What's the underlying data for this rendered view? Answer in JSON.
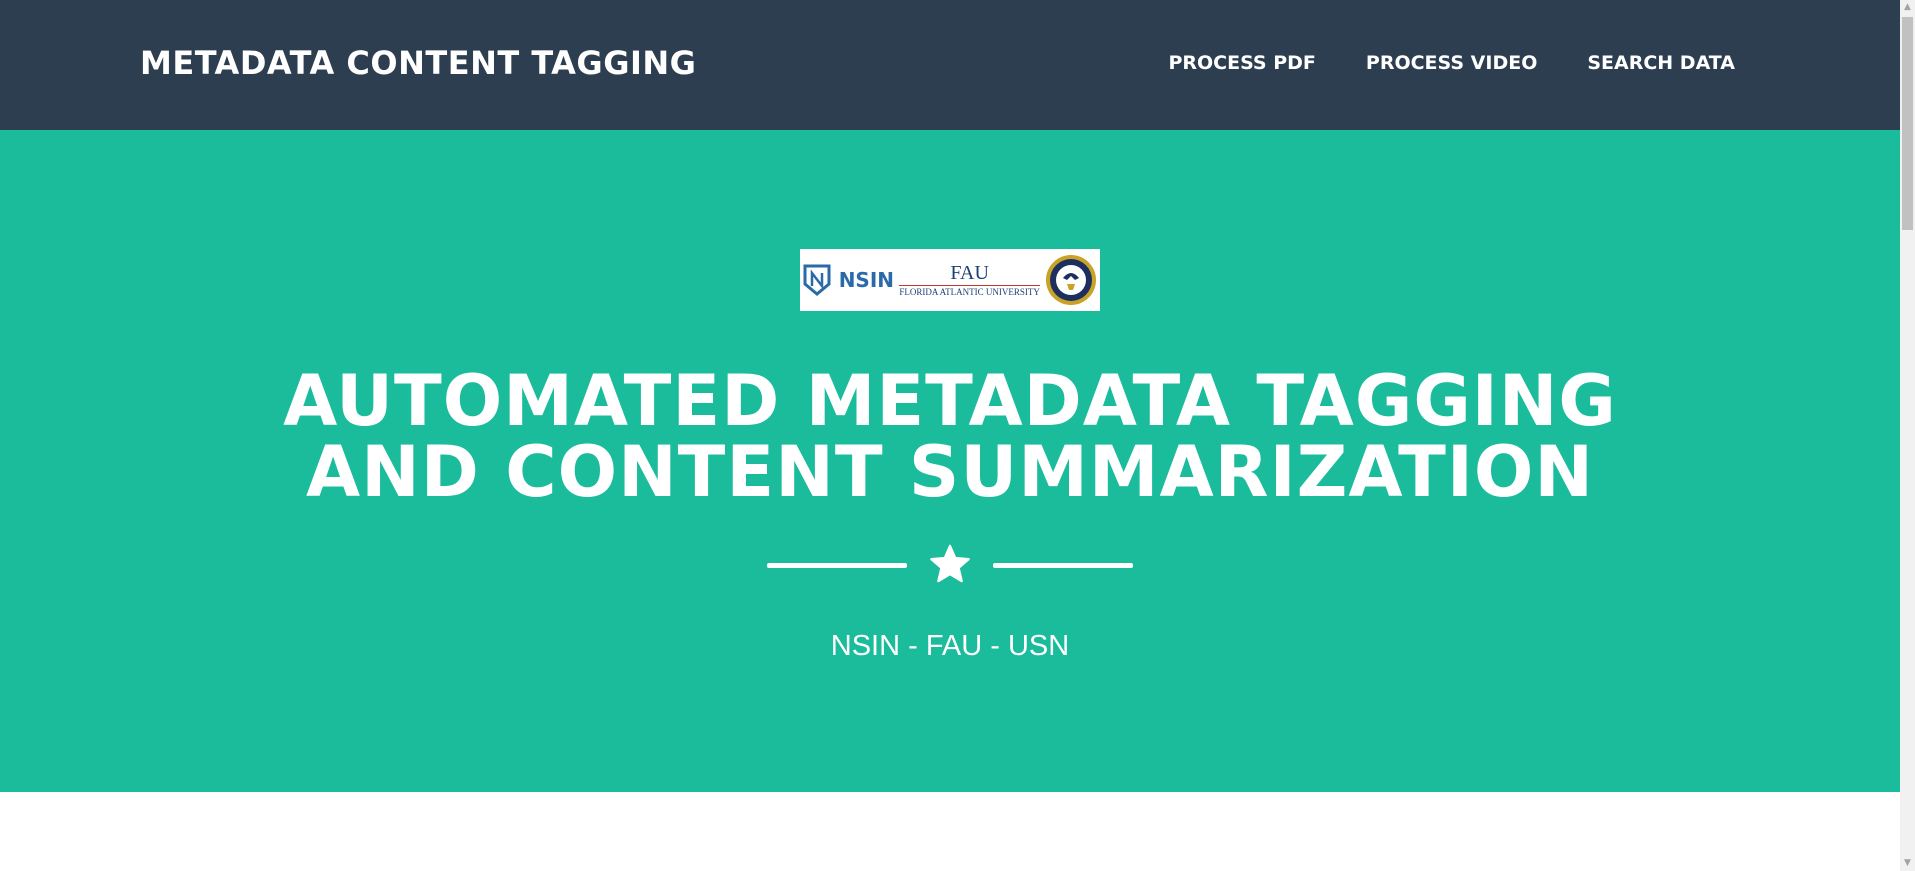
{
  "navbar": {
    "brand": "METADATA CONTENT TAGGING",
    "links": [
      {
        "label": "PROCESS PDF"
      },
      {
        "label": "PROCESS VIDEO"
      },
      {
        "label": "SEARCH DATA"
      }
    ]
  },
  "hero": {
    "logos": {
      "nsin": "NSIN",
      "fau_mark": "FAU",
      "fau_name": "FLORIDA ATLANTIC UNIVERSITY"
    },
    "title_line1": "AUTOMATED METADATA TAGGING",
    "title_line2": "AND CONTENT SUMMARIZATION",
    "divider_icon": "star-icon",
    "subtitle": "NSIN - FAU - USN"
  },
  "colors": {
    "navbar_bg": "#2c3e50",
    "hero_bg": "#1abc9c",
    "text": "#ffffff"
  }
}
